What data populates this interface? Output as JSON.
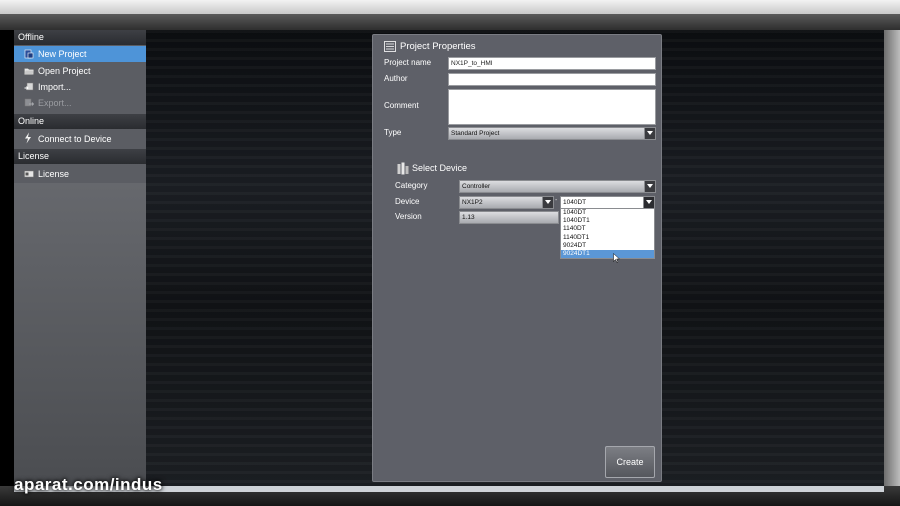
{
  "sidebar": {
    "offline_header": "Offline",
    "offline_items": [
      {
        "label": "New Project",
        "icon": "new-project-icon"
      },
      {
        "label": "Open Project",
        "icon": "folder-open-icon"
      },
      {
        "label": "Import...",
        "icon": "import-icon"
      },
      {
        "label": "Export...",
        "icon": "export-icon"
      }
    ],
    "online_header": "Online",
    "online_items": [
      {
        "label": "Connect to Device",
        "icon": "lightning-icon"
      }
    ],
    "license_header": "License",
    "license_items": [
      {
        "label": "License",
        "icon": "license-icon"
      }
    ]
  },
  "dialog": {
    "title": "Project Properties",
    "project_name_label": "Project name",
    "project_name_value": "NX1P_to_HMI",
    "author_label": "Author",
    "author_value": "",
    "comment_label": "Comment",
    "comment_value": "",
    "type_label": "Type",
    "type_value": "Standard Project",
    "select_device_title": "Select Device",
    "category_label": "Category",
    "category_value": "Controller",
    "device_label": "Device",
    "device_series_value": "NX1P2",
    "device_model_value": "1040DT",
    "version_label": "Version",
    "version_value": "1.13",
    "device_options": [
      "1040DT",
      "1040DT1",
      "1140DT",
      "1140DT1",
      "9024DT",
      "9024DT1"
    ],
    "highlighted_option": "9024DT1",
    "create_label": "Create"
  },
  "watermark": "aparat.com/indus",
  "colors": {
    "selected_item": "#4e94d8",
    "dialog_bg": "#5e6068",
    "sidebar_bg": "#5b5d63"
  }
}
